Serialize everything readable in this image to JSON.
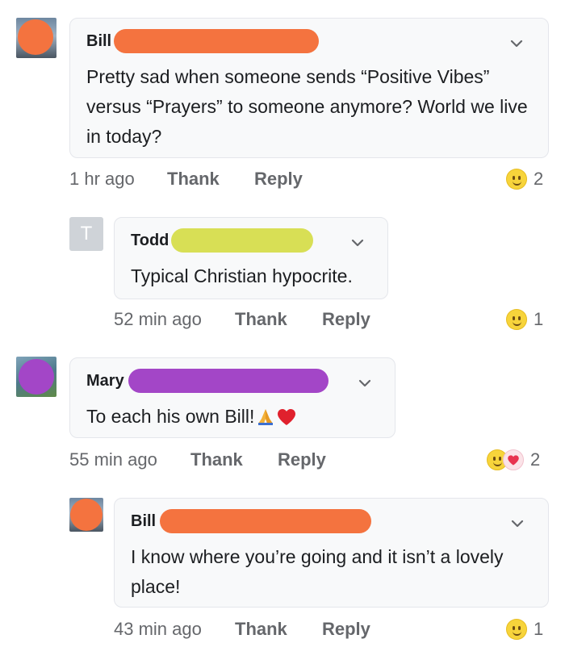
{
  "comments": [
    {
      "author": "Bill",
      "text": "Pretty sad when someone sends “Positive Vibes” versus “Prayers” to someone anymore? World we live in today?",
      "time": "1 hr ago",
      "thank": "Thank",
      "reply": "Reply",
      "reaction_count": "2"
    },
    {
      "author": "Todd",
      "avatar_letter": "T",
      "text": "Typical Christian hypocrite.",
      "time": "52 min ago",
      "thank": "Thank",
      "reply": "Reply",
      "reaction_count": "1"
    },
    {
      "author": "Mary",
      "text": "To each his own Bill!",
      "time": "55 min ago",
      "thank": "Thank",
      "reply": "Reply",
      "reaction_count": "2"
    },
    {
      "author": "Bill",
      "text": "I know where you’re going and it isn’t a lovely place!",
      "time": "43 min ago",
      "thank": "Thank",
      "reply": "Reply",
      "reaction_count": "1"
    }
  ],
  "colors": {
    "redact_orange": "#f4733f",
    "redact_yellow": "#d8df55",
    "redact_purple": "#a346c7",
    "bubble_bg": "#f8f9fa",
    "muted_text": "#65676b"
  }
}
